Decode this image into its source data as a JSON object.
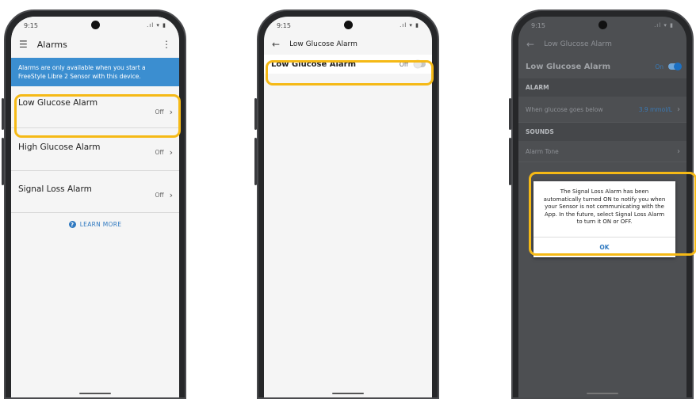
{
  "phone1": {
    "status": {
      "time": "9:15",
      "icons": ".ıl ▾ ▮"
    },
    "appbar": {
      "menu_icon": "hamburger-icon",
      "title": "Alarms",
      "more_icon": "more-vert-icon"
    },
    "banner": "Alarms are only available when you start a FreeStyle Libre 2 Sensor with this device.",
    "alarms": [
      {
        "label": "Low Glucose Alarm",
        "state": "Off"
      },
      {
        "label": "High Glucose Alarm",
        "state": "Off"
      },
      {
        "label": "Signal Loss Alarm",
        "state": "Off"
      }
    ],
    "learn_more": "LEARN MORE"
  },
  "phone2": {
    "status": {
      "time": "9:15",
      "icons": ".ıl ▾ ▮"
    },
    "appbar": {
      "back_icon": "arrow-left-icon",
      "title": "Low Glucose Alarm"
    },
    "row": {
      "label": "Low Glucose Alarm",
      "state": "Off"
    }
  },
  "phone3": {
    "status": {
      "time": "9:15",
      "icons": ".ıl ▾ ▮"
    },
    "appbar": {
      "back_icon": "arrow-left-icon",
      "title": "Low Glucose Alarm"
    },
    "toggle_row": {
      "label": "Low Glucose Alarm",
      "state": "On"
    },
    "alarm_section": "ALARM",
    "threshold_row": {
      "label": "When glucose goes below",
      "value": "3.9 mmol/L"
    },
    "sounds_section": "SOUNDS",
    "tone_row": {
      "label": "Alarm Tone"
    },
    "dialog": {
      "message": "The Signal Loss Alarm has been automatically turned ON to notify you when your Sensor is not communicating with the App. In the future, select Signal Loss Alarm to turn it ON or OFF.",
      "ok": "OK"
    }
  },
  "colors": {
    "highlight": "#f5b916",
    "accent": "#3b8ed0",
    "phone_frame": "#262729"
  }
}
